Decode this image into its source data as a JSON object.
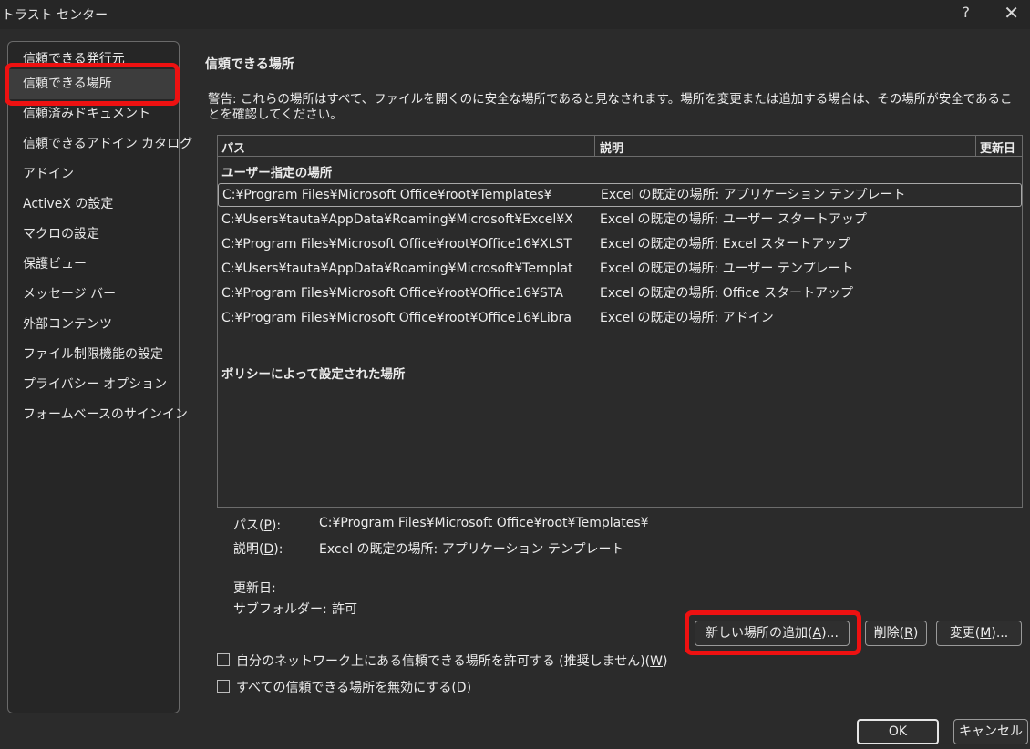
{
  "window": {
    "title": "トラスト センター",
    "help": "?",
    "close": "✕"
  },
  "sidebar": {
    "items": [
      "信頼できる発行元",
      "信頼できる場所",
      "信頼済みドキュメント",
      "信頼できるアドイン カタログ",
      "アドイン",
      "ActiveX の設定",
      "マクロの設定",
      "保護ビュー",
      "メッセージ バー",
      "外部コンテンツ",
      "ファイル制限機能の設定",
      "プライバシー オプション",
      "フォームベースのサインイン"
    ],
    "selected_index": 1
  },
  "main": {
    "section_title": "信頼できる場所",
    "warning": "警告: これらの場所はすべて、ファイルを開くのに安全な場所であると見なされます。場所を変更または追加する場合は、その場所が安全であることを確認してください。",
    "table": {
      "headers": {
        "path": "パス",
        "description": "説明",
        "modified": "更新日"
      },
      "group_user": "ユーザー指定の場所",
      "rows": [
        {
          "path": "C:¥Program Files¥Microsoft Office¥root¥Templates¥",
          "description": "Excel の既定の場所: アプリケーション テンプレート"
        },
        {
          "path": "C:¥Users¥tauta¥AppData¥Roaming¥Microsoft¥Excel¥X",
          "description": "Excel の既定の場所: ユーザー スタートアップ"
        },
        {
          "path": "C:¥Program Files¥Microsoft Office¥root¥Office16¥XLST",
          "description": "Excel の既定の場所: Excel スタートアップ"
        },
        {
          "path": "C:¥Users¥tauta¥AppData¥Roaming¥Microsoft¥Templat",
          "description": "Excel の既定の場所: ユーザー テンプレート"
        },
        {
          "path": "C:¥Program Files¥Microsoft Office¥root¥Office16¥STA",
          "description": "Excel の既定の場所: Office スタートアップ"
        },
        {
          "path": "C:¥Program Files¥Microsoft Office¥root¥Office16¥Libra",
          "description": "Excel の既定の場所: アドイン"
        }
      ],
      "group_policy": "ポリシーによって設定された場所"
    },
    "details": {
      "path_label": "パス(",
      "path_key": "P",
      "path_label_end": "):",
      "path_value": "C:¥Program Files¥Microsoft Office¥root¥Templates¥",
      "desc_label": "説明(",
      "desc_key": "D",
      "desc_label_end": "):",
      "desc_value": "Excel の既定の場所: アプリケーション テンプレート",
      "modified_label": "更新日:",
      "subfolder_label": "サブフォルダー:",
      "subfolder_value": "許可"
    },
    "buttons": {
      "add": {
        "text": "新しい場所の追加(",
        "key": "A",
        "end": ")..."
      },
      "remove": {
        "text": "削除(",
        "key": "R",
        "end": ")"
      },
      "modify": {
        "text": "変更(",
        "key": "M",
        "end": ")..."
      }
    },
    "checkboxes": {
      "network": {
        "text": "自分のネットワーク上にある信頼できる場所を許可する (推奨しません)(",
        "key": "W",
        "end": ")"
      },
      "disable_all": {
        "text": "すべての信頼できる場所を無効にする(",
        "key": "D",
        "end": ")"
      }
    }
  },
  "footer": {
    "ok": "OK",
    "cancel": "キャンセル"
  },
  "colors": {
    "background": "#2b2b2b",
    "highlight": "#ee1111",
    "text": "#ececec"
  }
}
